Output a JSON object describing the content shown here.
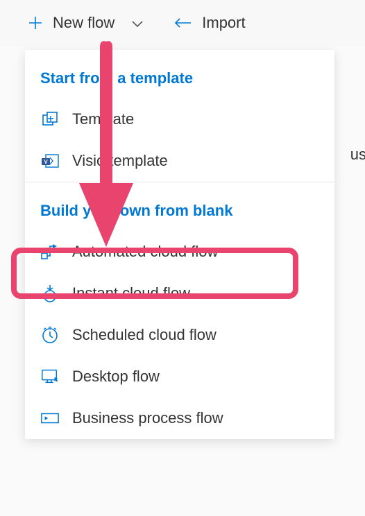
{
  "toolbar": {
    "new_flow_label": "New flow",
    "import_label": "Import"
  },
  "dropdown": {
    "section1_header": "Start from a template",
    "template_label": "Template",
    "visio_template_label": "Visio template",
    "section2_header": "Build your own from blank",
    "automated_label": "Automated cloud flow",
    "instant_label": "Instant cloud flow",
    "scheduled_label": "Scheduled cloud flow",
    "desktop_label": "Desktop flow",
    "business_label": "Business process flow"
  },
  "background_partial": "us",
  "annotation": {
    "highlight_target": "automated-cloud-flow",
    "arrow_color": "#e9446d"
  }
}
